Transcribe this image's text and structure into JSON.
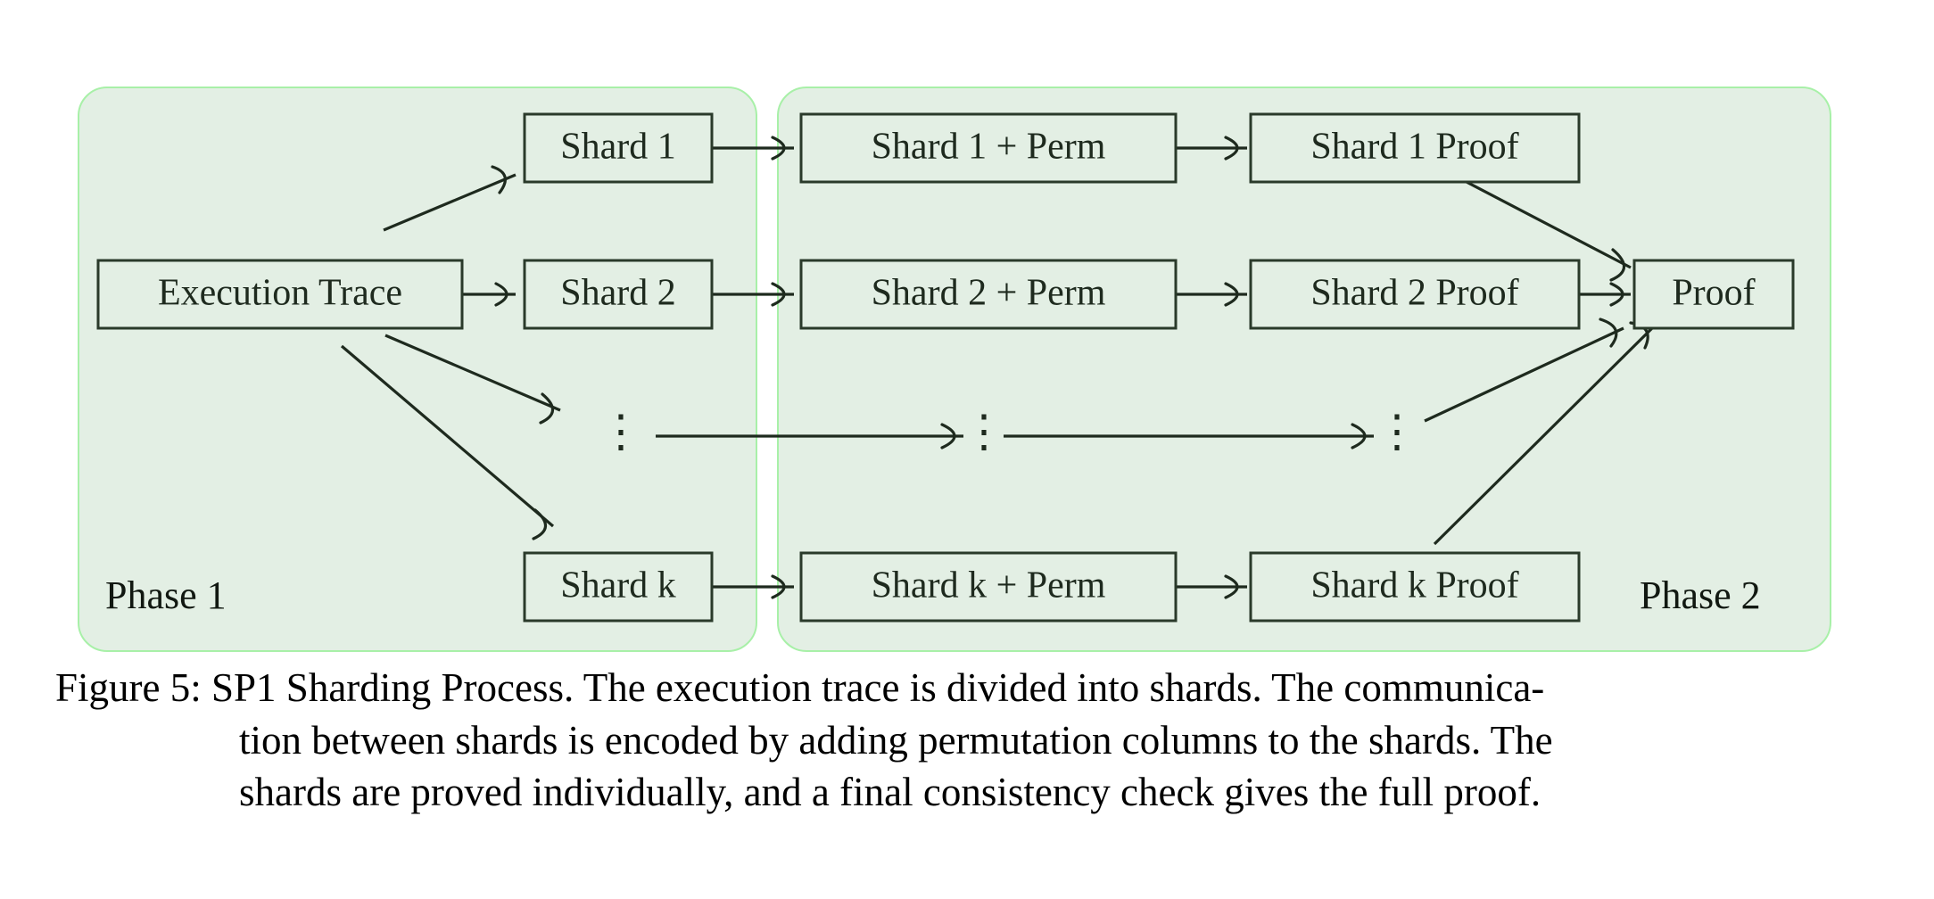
{
  "figure": {
    "phase1": {
      "label": "Phase 1",
      "nodes": [
        {
          "id": "execution-trace",
          "label": "Execution Trace"
        },
        {
          "id": "shard-1",
          "label": "Shard 1"
        },
        {
          "id": "shard-2",
          "label": "Shard 2"
        },
        {
          "id": "shard-dots",
          "label": "⋮"
        },
        {
          "id": "shard-k",
          "label": "Shard k"
        }
      ]
    },
    "phase2": {
      "label": "Phase 2",
      "nodes": [
        {
          "id": "shard-1-perm",
          "label": "Shard 1 + Perm"
        },
        {
          "id": "shard-2-perm",
          "label": "Shard 2 + Perm"
        },
        {
          "id": "perm-dots",
          "label": "⋮"
        },
        {
          "id": "shard-k-perm",
          "label": "Shard k + Perm"
        },
        {
          "id": "shard-1-proof",
          "label": "Shard 1 Proof"
        },
        {
          "id": "shard-2-proof",
          "label": "Shard 2 Proof"
        },
        {
          "id": "proof-dots",
          "label": "⋮"
        },
        {
          "id": "shard-k-proof",
          "label": "Shard k Proof"
        },
        {
          "id": "proof",
          "label": "Proof"
        }
      ]
    },
    "colors": {
      "panel_fill": "#e3efe4",
      "panel_stroke": "#a8f0a8",
      "box_stroke": "#2a3a2a",
      "edge": "#1e2a1e",
      "text": "#1e2a1e",
      "page_background": "#ffffff"
    }
  },
  "caption": {
    "line1": "Figure 5: SP1 Sharding Process. The execution trace is divided into shards. The communica-",
    "line2": "tion between shards is encoded by adding permutation columns to the shards. The",
    "line3": "shards are proved individually, and a final consistency check gives the full proof.",
    "full": "Figure 5: SP1 Sharding Process. The execution trace is divided into shards. The communication between shards is encoded by adding permutation columns to the shards. The shards are proved individually, and a final consistency check gives the full proof."
  },
  "chart_data": {
    "type": "diagram",
    "title": "SP1 Sharding Process",
    "groups": [
      {
        "name": "Phase 1",
        "members": [
          "Execution Trace",
          "Shard 1",
          "Shard 2",
          "⋮",
          "Shard k"
        ]
      },
      {
        "name": "Phase 2",
        "members": [
          "Shard 1 + Perm",
          "Shard 2 + Perm",
          "⋮",
          "Shard k + Perm",
          "Shard 1 Proof",
          "Shard 2 Proof",
          "⋮",
          "Shard k Proof",
          "Proof"
        ]
      }
    ],
    "edges": [
      {
        "from": "Execution Trace",
        "to": "Shard 1"
      },
      {
        "from": "Execution Trace",
        "to": "Shard 2"
      },
      {
        "from": "Execution Trace",
        "to": "⋮"
      },
      {
        "from": "Execution Trace",
        "to": "Shard k"
      },
      {
        "from": "Shard 1",
        "to": "Shard 1 + Perm"
      },
      {
        "from": "Shard 2",
        "to": "Shard 2 + Perm"
      },
      {
        "from": "⋮",
        "to": "⋮"
      },
      {
        "from": "Shard k",
        "to": "Shard k + Perm"
      },
      {
        "from": "Shard 1 + Perm",
        "to": "Shard 1 Proof"
      },
      {
        "from": "Shard 2 + Perm",
        "to": "Shard 2 Proof"
      },
      {
        "from": "⋮",
        "to": "⋮"
      },
      {
        "from": "Shard k + Perm",
        "to": "Shard k Proof"
      },
      {
        "from": "Shard 1 Proof",
        "to": "Proof"
      },
      {
        "from": "Shard 2 Proof",
        "to": "Proof"
      },
      {
        "from": "⋮",
        "to": "Proof"
      },
      {
        "from": "Shard k Proof",
        "to": "Proof"
      }
    ]
  }
}
